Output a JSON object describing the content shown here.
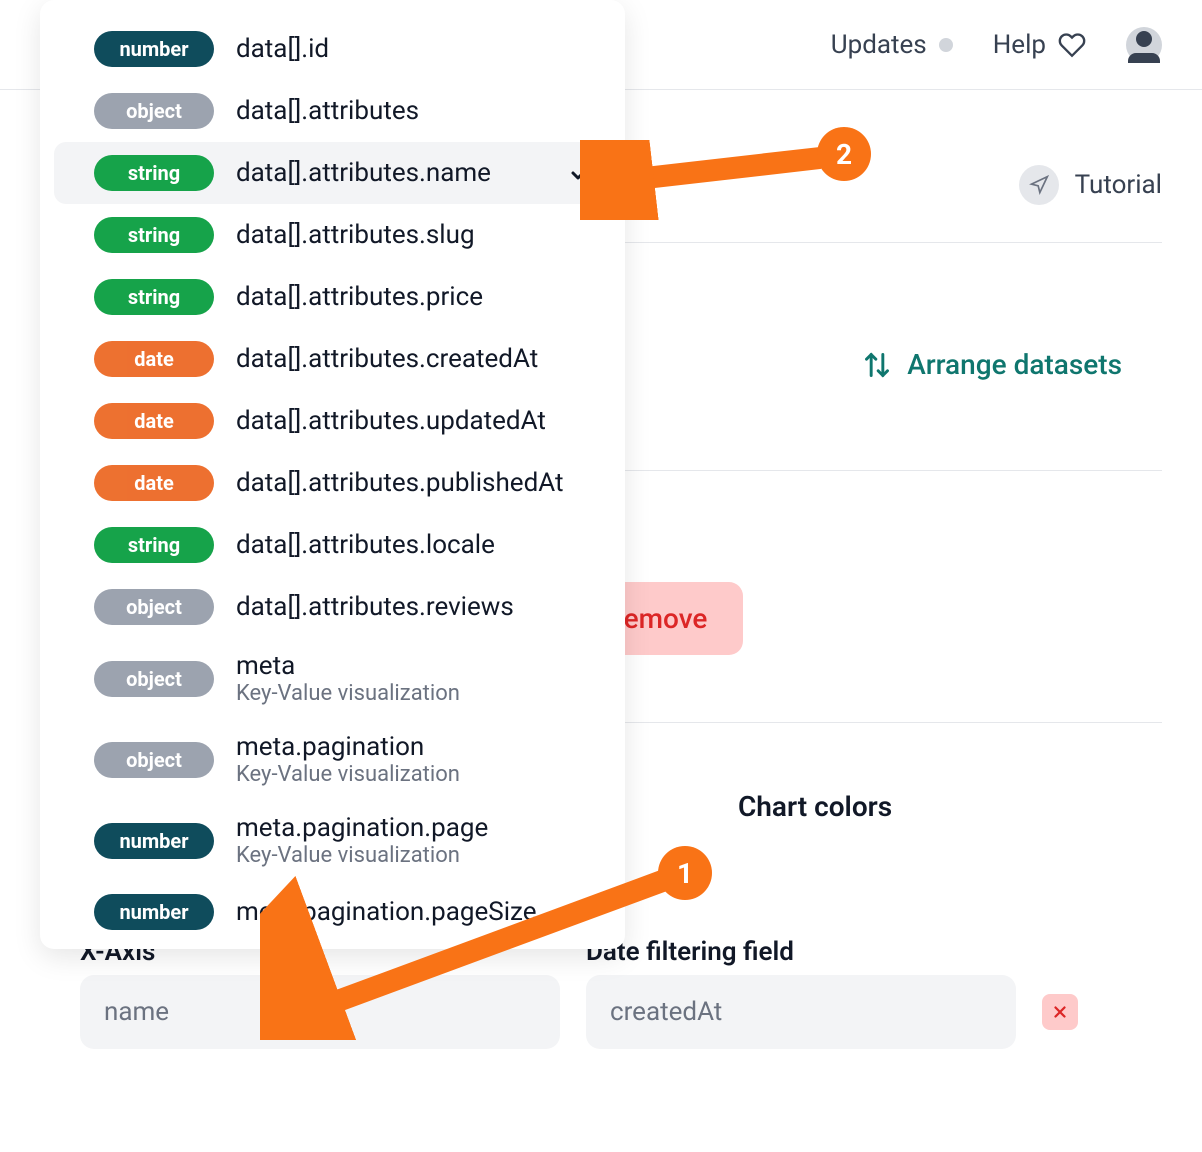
{
  "topbar": {
    "updates": "Updates",
    "help": "Help"
  },
  "tutorial": {
    "label": "Tutorial"
  },
  "arrange": {
    "label": "Arrange datasets"
  },
  "remove_btn": "Remove",
  "chart_colors": "Chart colors",
  "fields": {
    "xaxis_label": "X-Axis",
    "xaxis_value": "name",
    "date_label": "Date filtering field",
    "date_value": "createdAt"
  },
  "dropdown": {
    "items": [
      {
        "type": "number",
        "type_label": "number",
        "path": "data[].id",
        "sub": ""
      },
      {
        "type": "object",
        "type_label": "object",
        "path": "data[].attributes",
        "sub": ""
      },
      {
        "type": "string",
        "type_label": "string",
        "path": "data[].attributes.name",
        "sub": "",
        "selected": true
      },
      {
        "type": "string",
        "type_label": "string",
        "path": "data[].attributes.slug",
        "sub": ""
      },
      {
        "type": "string",
        "type_label": "string",
        "path": "data[].attributes.price",
        "sub": ""
      },
      {
        "type": "date",
        "type_label": "date",
        "path": "data[].attributes.createdAt",
        "sub": ""
      },
      {
        "type": "date",
        "type_label": "date",
        "path": "data[].attributes.updatedAt",
        "sub": ""
      },
      {
        "type": "date",
        "type_label": "date",
        "path": "data[].attributes.publishedAt",
        "sub": ""
      },
      {
        "type": "string",
        "type_label": "string",
        "path": "data[].attributes.locale",
        "sub": ""
      },
      {
        "type": "object",
        "type_label": "object",
        "path": "data[].attributes.reviews",
        "sub": ""
      },
      {
        "type": "object",
        "type_label": "object",
        "path": "meta",
        "sub": "Key-Value visualization"
      },
      {
        "type": "object",
        "type_label": "object",
        "path": "meta.pagination",
        "sub": "Key-Value visualization"
      },
      {
        "type": "number",
        "type_label": "number",
        "path": "meta.pagination.page",
        "sub": "Key-Value visualization"
      },
      {
        "type": "number",
        "type_label": "number",
        "path": "meta.pagination.pageSize",
        "sub": ""
      }
    ]
  },
  "markers": {
    "one": "1",
    "two": "2"
  }
}
